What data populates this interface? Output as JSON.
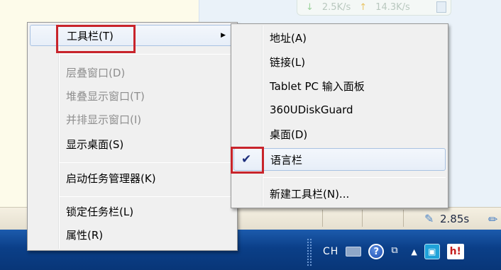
{
  "background": {
    "speed_down": "2.5K/s",
    "speed_up": "14.3K/s",
    "status_time": "2.85s"
  },
  "taskbar": {
    "language": "CH",
    "help_label": "?",
    "app2_label": "h!",
    "up_arrow": "▲"
  },
  "context_menu": {
    "items": [
      {
        "label": "工具栏(T)",
        "submenu": true,
        "highlighted": true
      },
      {
        "label": "层叠窗口(D)",
        "enabled": false
      },
      {
        "label": "堆叠显示窗口(T)",
        "enabled": false
      },
      {
        "label": "并排显示窗口(I)",
        "enabled": false
      },
      {
        "label": "显示桌面(S)",
        "enabled": true
      },
      {
        "label": "启动任务管理器(K)",
        "enabled": true
      },
      {
        "label": "锁定任务栏(L)",
        "enabled": true
      },
      {
        "label": "属性(R)",
        "enabled": true
      }
    ],
    "submenu_arrow": "▶"
  },
  "toolbar_submenu": {
    "items": [
      {
        "label": "地址(A)",
        "checked": false
      },
      {
        "label": "链接(L)",
        "checked": false
      },
      {
        "label": "Tablet PC 输入面板",
        "checked": false
      },
      {
        "label": "360UDiskGuard",
        "checked": false
      },
      {
        "label": "桌面(D)",
        "checked": false
      },
      {
        "label": "语言栏",
        "checked": true
      },
      {
        "label": "新建工具栏(N)...",
        "checked": false
      }
    ],
    "check_mark": "✔"
  },
  "accent": {
    "highlight_red": "#c8242b",
    "taskbar_blue": "#0b3f88"
  }
}
